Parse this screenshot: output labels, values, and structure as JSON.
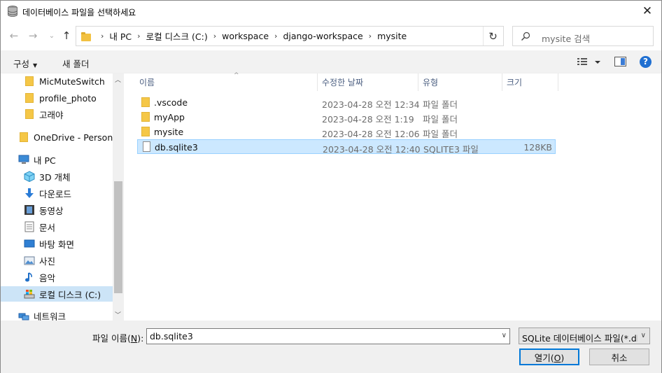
{
  "window": {
    "title": "데이터베이스 파일을 선택하세요",
    "close_glyph": "✕"
  },
  "address": {
    "crumbs": [
      "내 PC",
      "로컬 디스크 (C:)",
      "workspace",
      "django-workspace",
      "mysite"
    ],
    "separator": "›",
    "search_placeholder": "mysite 검색"
  },
  "toolbar": {
    "organize_label": "구성",
    "new_folder_label": "새 폴더"
  },
  "navpane": {
    "items": [
      {
        "label": "MicMuteSwitch",
        "icon": "folder-icon"
      },
      {
        "label": "profile_photo",
        "icon": "folder-icon"
      },
      {
        "label": "고래야",
        "icon": "folder-icon"
      },
      {
        "label": "OneDrive - Personal",
        "icon": "onedrive-folder-icon"
      },
      {
        "label": "내 PC",
        "icon": "pc-icon"
      },
      {
        "label": "3D 개체",
        "icon": "3d-objects-icon"
      },
      {
        "label": "다운로드",
        "icon": "download-icon"
      },
      {
        "label": "동영상",
        "icon": "video-icon"
      },
      {
        "label": "문서",
        "icon": "document-icon"
      },
      {
        "label": "바탕 화면",
        "icon": "desktop-icon"
      },
      {
        "label": "사진",
        "icon": "pictures-icon"
      },
      {
        "label": "음악",
        "icon": "music-icon"
      },
      {
        "label": "로컬 디스크 (C:)",
        "icon": "local-disk-icon"
      },
      {
        "label": "네트워크",
        "icon": "network-icon"
      }
    ]
  },
  "filelist": {
    "columns": {
      "name": "이름",
      "date": "수정한 날짜",
      "type": "유형",
      "size": "크기"
    },
    "rows": [
      {
        "name": ".vscode",
        "date": "2023-04-28 오전 12:34",
        "type": "파일 폴더",
        "size": ""
      },
      {
        "name": "myApp",
        "date": "2023-04-28 오전 1:19",
        "type": "파일 폴더",
        "size": ""
      },
      {
        "name": "mysite",
        "date": "2023-04-28 오전 12:06",
        "type": "파일 폴더",
        "size": ""
      },
      {
        "name": "db.sqlite3",
        "date": "2023-04-28 오전 12:40",
        "type": "SQLITE3 파일",
        "size": "128KB"
      }
    ]
  },
  "bottom": {
    "filename_label_pre": "파일 이름(",
    "filename_label_key": "N",
    "filename_label_post": "):",
    "filename_value": "db.sqlite3",
    "filetype_value": "SQLite 데이터베이스 파일(*.db",
    "open_label_pre": "열기(",
    "open_label_key": "O",
    "open_label_post": ")",
    "cancel_label": "취소"
  }
}
